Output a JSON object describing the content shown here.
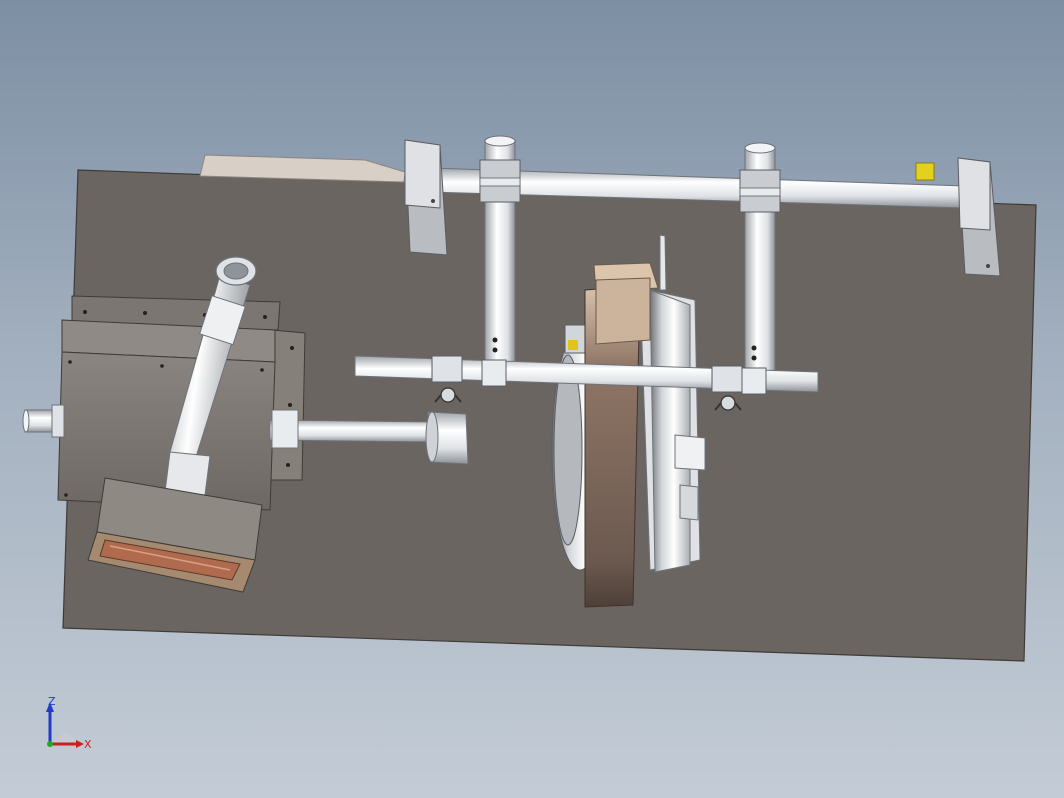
{
  "triad": {
    "z_label": "Z",
    "x_label": "X"
  },
  "colors": {
    "background_top": "#7d8fa4",
    "background_bottom": "#c3ccd6",
    "base_plate": "#6a6560",
    "tube": "#e9ecef",
    "clamp_block": "#c9ccd1",
    "wheel_brown": "#cbb39b",
    "indicator_yellow": "#e2d21e",
    "z_axis": "#1e3cc8",
    "x_axis": "#cc2020",
    "y_axis": "#20aa20"
  },
  "icons": [
    "coordinate-triad-icon"
  ]
}
